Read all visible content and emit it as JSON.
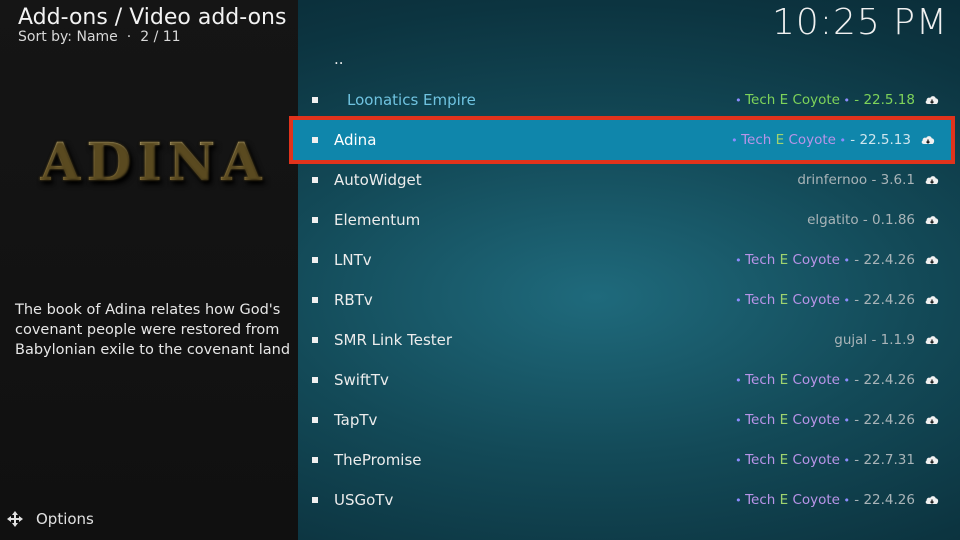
{
  "header": {
    "title": "Add-ons / Video add-ons",
    "sort_label": "Sort by: Name",
    "position": "2 / 11",
    "clock": "10:25 PM"
  },
  "left_panel": {
    "logo_text": "ADINA",
    "description": "The book of Adina relates how God's covenant people were restored from Babylonian exile to the covenant land",
    "options_label": "Options"
  },
  "list": {
    "parent_label": "..",
    "items": [
      {
        "name": "Loonatics Empire",
        "author_parts": [
          "Tech",
          "E",
          "Coyote"
        ],
        "version": "22.5.18",
        "style": "green"
      },
      {
        "name": "Adina",
        "author_parts": [
          "Tech",
          "E",
          "Coyote"
        ],
        "version": "22.5.13",
        "selected": true
      },
      {
        "name": "AutoWidget",
        "author": "drinfernoo",
        "version": "3.6.1"
      },
      {
        "name": "Elementum",
        "author": "elgatito",
        "version": "0.1.86"
      },
      {
        "name": "LNTv",
        "author_parts": [
          "Tech",
          "E",
          "Coyote"
        ],
        "version": "22.4.26"
      },
      {
        "name": "RBTv",
        "author_parts": [
          "Tech",
          "E",
          "Coyote"
        ],
        "version": "22.4.26"
      },
      {
        "name": "SMR Link Tester",
        "author": "gujal",
        "version": "1.1.9"
      },
      {
        "name": "SwiftTv",
        "author_parts": [
          "Tech",
          "E",
          "Coyote"
        ],
        "version": "22.4.26"
      },
      {
        "name": "TapTv",
        "author_parts": [
          "Tech",
          "E",
          "Coyote"
        ],
        "version": "22.4.26"
      },
      {
        "name": "ThePromise",
        "author_parts": [
          "Tech",
          "E",
          "Coyote"
        ],
        "version": "22.7.31"
      },
      {
        "name": "USGoTv",
        "author_parts": [
          "Tech",
          "E",
          "Coyote"
        ],
        "version": "22.4.26"
      }
    ],
    "separator": "-"
  },
  "colors": {
    "selected_bg": "#0f86ab",
    "highlight_border": "#e1331c",
    "author_purple": "#b994e8",
    "author_green": "#7ed35a"
  }
}
